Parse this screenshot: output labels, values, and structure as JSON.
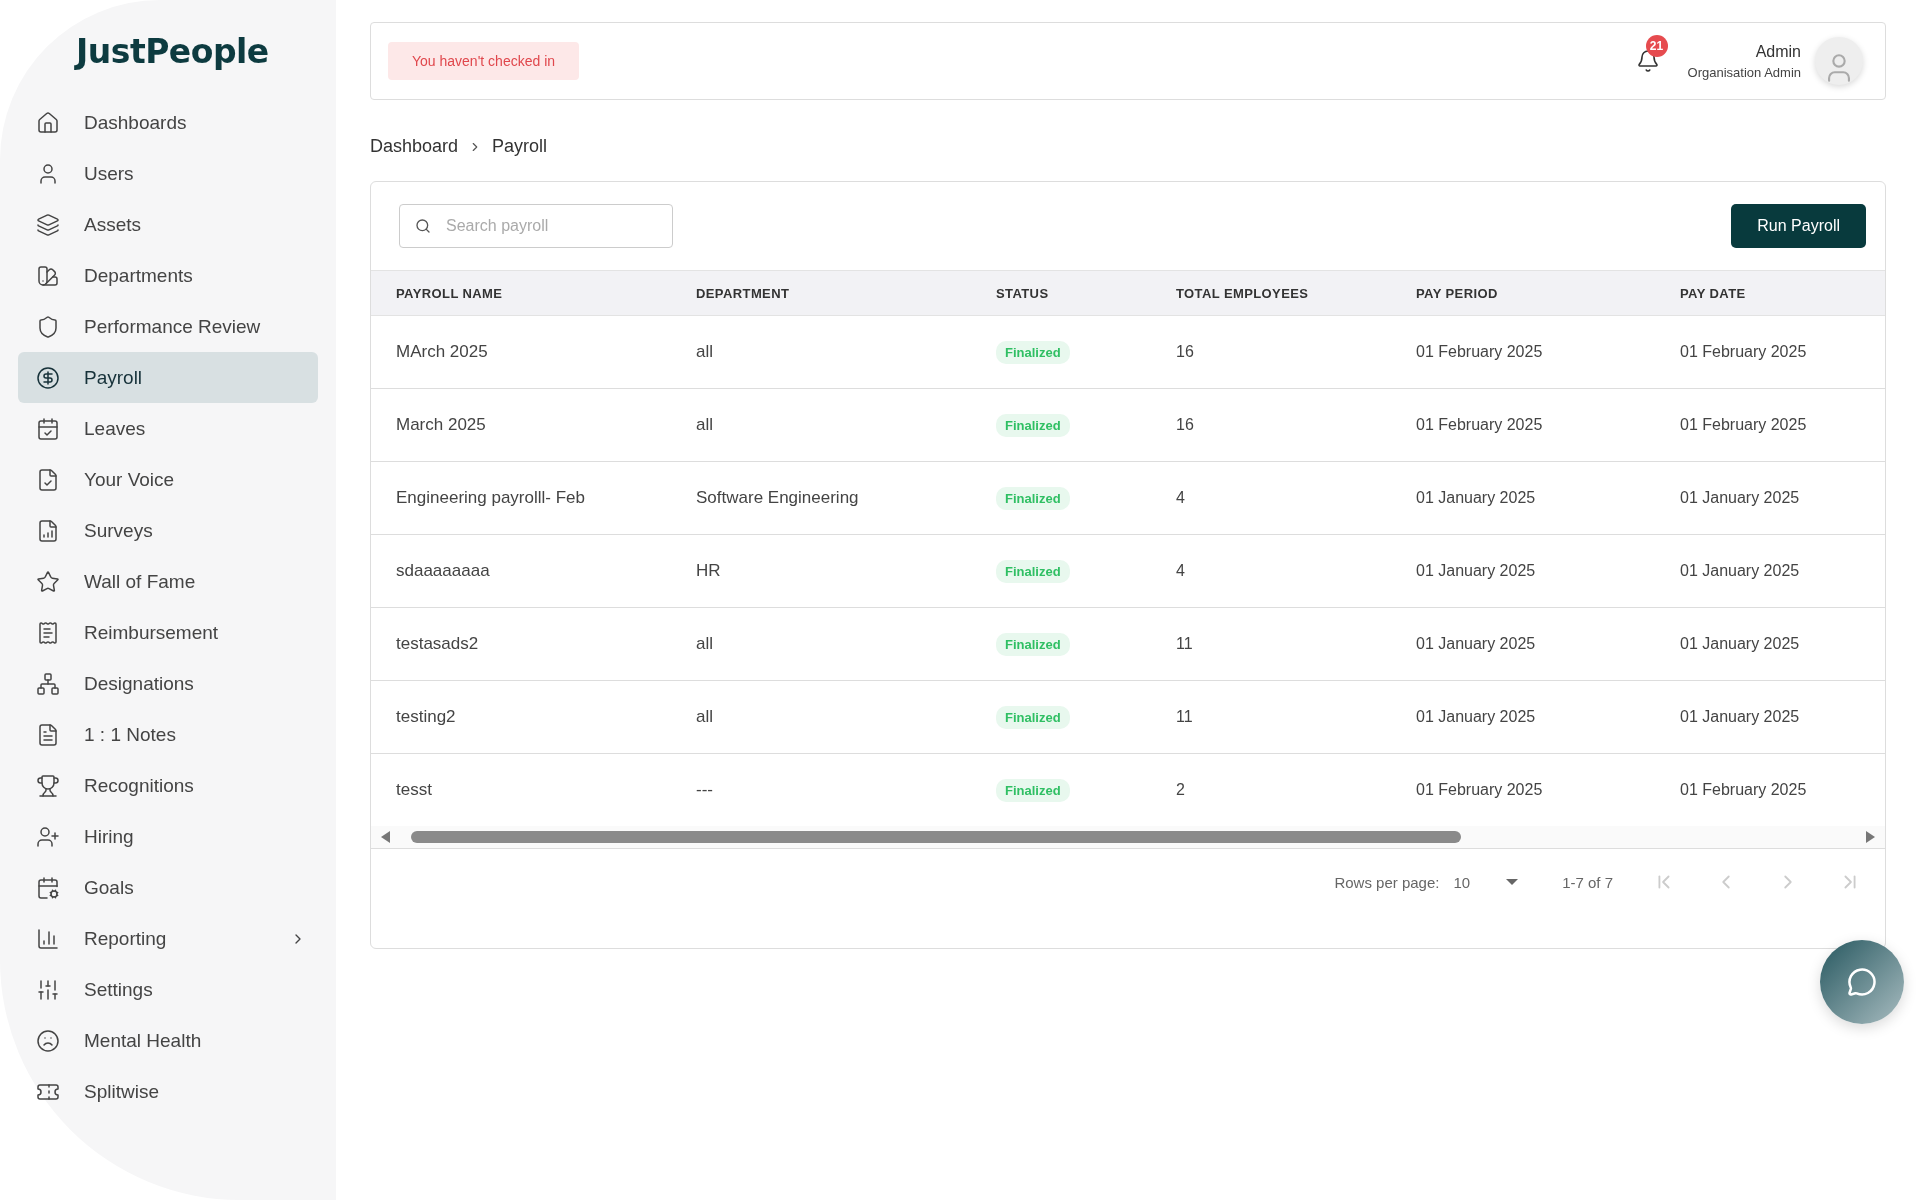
{
  "brand": "JustPeople",
  "sidebar": {
    "items": [
      {
        "label": "Dashboards",
        "kind": "link",
        "selected": false
      },
      {
        "label": "Users",
        "kind": "link",
        "selected": false
      },
      {
        "label": "Assets",
        "kind": "link",
        "selected": false
      },
      {
        "label": "Departments",
        "kind": "link",
        "selected": false
      },
      {
        "label": "Performance Review",
        "kind": "link",
        "selected": false
      },
      {
        "label": "Payroll",
        "kind": "link",
        "selected": true
      },
      {
        "label": "Leaves",
        "kind": "link",
        "selected": false
      },
      {
        "label": "Your Voice",
        "kind": "link",
        "selected": false
      },
      {
        "label": "Surveys",
        "kind": "link",
        "selected": false
      },
      {
        "label": "Wall of Fame",
        "kind": "link",
        "selected": false
      },
      {
        "label": "Reimbursement",
        "kind": "link",
        "selected": false
      },
      {
        "label": "Designations",
        "kind": "link",
        "selected": false
      },
      {
        "label": "1 : 1 Notes",
        "kind": "link",
        "selected": false
      },
      {
        "label": "Recognitions",
        "kind": "link",
        "selected": false
      },
      {
        "label": "Hiring",
        "kind": "link",
        "selected": false
      },
      {
        "label": "Goals",
        "kind": "link",
        "selected": false
      },
      {
        "label": "Reporting",
        "kind": "group",
        "selected": false
      },
      {
        "label": "Settings",
        "kind": "link",
        "selected": false
      },
      {
        "label": "Mental Health",
        "kind": "link",
        "selected": false
      },
      {
        "label": "Splitwise",
        "kind": "link",
        "selected": false
      }
    ]
  },
  "header": {
    "checkin_notice": "You haven't checked in",
    "notification_count": "21",
    "user_name": "Admin",
    "user_role": "Organisation Admin"
  },
  "breadcrumb": [
    "Dashboard",
    "Payroll"
  ],
  "search": {
    "placeholder": "Search payroll"
  },
  "run_button": "Run Payroll",
  "table": {
    "columns": [
      "PAYROLL NAME",
      "DEPARTMENT",
      "STATUS",
      "TOTAL EMPLOYEES",
      "PAY PERIOD",
      "PAY DATE"
    ],
    "rows": [
      [
        "MArch 2025",
        "all",
        "Finalized",
        "16",
        "01 February 2025",
        "01 February 2025"
      ],
      [
        "March 2025",
        "all",
        "Finalized",
        "16",
        "01 February 2025",
        "01 February 2025"
      ],
      [
        "Engineering payrolll- Feb",
        "Software Engineering",
        "Finalized",
        "4",
        "01 January 2025",
        "01 January 2025"
      ],
      [
        "sdaaaaaaaa",
        "HR",
        "Finalized",
        "4",
        "01 January 2025",
        "01 January 2025"
      ],
      [
        "testasads2",
        "all",
        "Finalized",
        "11",
        "01 January 2025",
        "01 January 2025"
      ],
      [
        "testing2",
        "all",
        "Finalized",
        "11",
        "01 January 2025",
        "01 January 2025"
      ],
      [
        "tesst",
        "---",
        "Finalized",
        "2",
        "01 February 2025",
        "01 February 2025"
      ]
    ]
  },
  "pagination": {
    "rows_per_page_label": "Rows per page:",
    "rows_per_page": "10",
    "range": "1-7 of 7"
  }
}
